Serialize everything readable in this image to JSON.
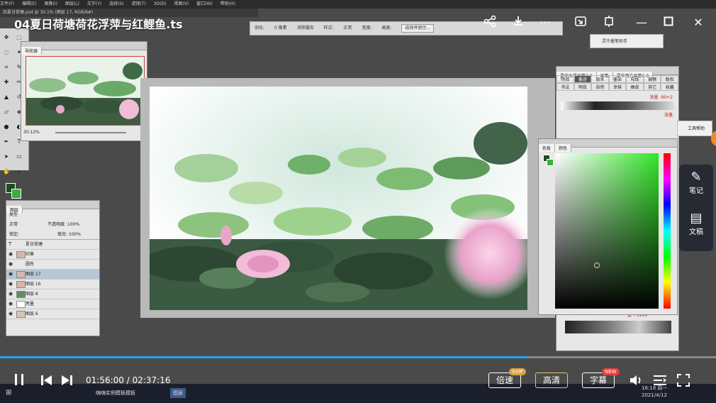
{
  "video": {
    "title": "04夏日荷塘荷花浮萍与红鲤鱼.ts",
    "current_time": "01:56:00",
    "separator": "/",
    "total_time": "02:37:16",
    "progress": 0.737,
    "speed_label": "倍速",
    "speed_badge": "SVIP",
    "quality_label": "高清",
    "subtitle_label": "字幕",
    "subtitle_badge": "NEW"
  },
  "side_panel": {
    "notes_label": "笔记",
    "manuscript_label": "文稿"
  },
  "photoshop": {
    "menu": [
      "文件(F)",
      "编辑(E)",
      "图像(I)",
      "图层(L)",
      "文字(Y)",
      "选择(S)",
      "滤镜(T)",
      "3D(D)",
      "视图(V)",
      "窗口(W)",
      "帮助(H)"
    ],
    "file_tab": "四夏日荷塘.psd @ 30.1% (图层 17, RGB/8#)",
    "options": [
      "羽化:",
      "0 像素",
      "消除锯齿",
      "样式:",
      "正常",
      "宽度:",
      "高度:"
    ],
    "options_button": "选择并遮住...",
    "navigator_tab": "导航器",
    "navigator_zoom": "30.12%",
    "layers": {
      "tab": "图层",
      "kind": "类型",
      "blend": "正常",
      "opacity_label": "不透明度:",
      "opacity": "100%",
      "lock_label": "锁定:",
      "fill_label": "填充:",
      "fill": "100%",
      "rows": [
        {
          "name": "夏日荷塘",
          "type": "T"
        },
        {
          "name": "印章"
        },
        {
          "name": "圆有"
        },
        {
          "name": "图层 17"
        },
        {
          "name": "图层 16"
        },
        {
          "name": "图层 8"
        },
        {
          "name": "亮墨"
        },
        {
          "name": "图层 6"
        }
      ]
    },
    "brush_panel": {
      "tabs": [
        "灵华水墨画笔7.0",
        "画笔",
        "灵华西方画笔6.0"
      ],
      "grid": [
        "特效",
        "墨迹",
        "泼水",
        "墨染",
        "勾线",
        "皴擦",
        "版权",
        "书法",
        "明效",
        "自然",
        "涂抹",
        "橡皮",
        "其它",
        "收藏"
      ],
      "tag1": "泼墨 -90+2",
      "tag2": "泼墨",
      "tag3": "墨 +12K4"
    },
    "color_panel": {
      "tabs": [
        "色板",
        "颜色"
      ]
    },
    "help_box": "灵华墨笔助手",
    "tool_help": "工具帮助"
  },
  "taskbar": {
    "item1": "嗨嗨实例模板模板",
    "item2": "图层",
    "clock_time": "16:18 周一",
    "clock_date": "2021/4/12"
  },
  "colors": {
    "accent": "#18a7f0",
    "svip": "#d9a53b",
    "new_badge": "#e8403f"
  }
}
